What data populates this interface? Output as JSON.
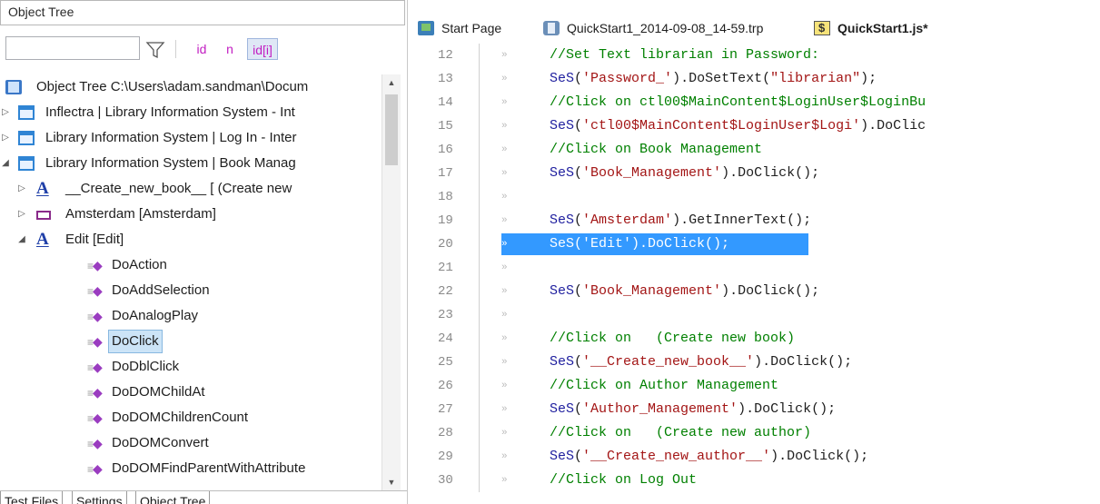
{
  "left_panel": {
    "title": "Object Tree",
    "filter": {
      "value": "",
      "placeholder": ""
    },
    "filter_buttons": [
      "id",
      "n",
      "id[i]"
    ],
    "tree_rows": [
      {
        "label": "Object Tree C:\\Users\\adam.sandman\\Docum",
        "icon": "object-tree-icon",
        "expander": ""
      },
      {
        "label": "Inflectra | Library Information System - Int",
        "icon": "window-icon",
        "expander": "▷"
      },
      {
        "label": "Library Information System | Log In - Inter",
        "icon": "window-icon",
        "expander": "▷"
      },
      {
        "label": "Library Information System | Book Manag",
        "icon": "window-icon",
        "expander": "◢"
      },
      {
        "label": "__Create_new_book__ [ (Create new",
        "icon": "link-icon",
        "expander": "▷"
      },
      {
        "label": "Amsterdam [Amsterdam]",
        "icon": "element-icon",
        "expander": "▷"
      },
      {
        "label": "Edit [Edit]",
        "icon": "link-icon",
        "expander": "◢"
      },
      {
        "label": "DoAction",
        "icon": "method-icon",
        "expander": ""
      },
      {
        "label": "DoAddSelection",
        "icon": "method-icon",
        "expander": ""
      },
      {
        "label": "DoAnalogPlay",
        "icon": "method-icon",
        "expander": ""
      },
      {
        "label": "DoClick",
        "icon": "method-icon",
        "expander": "",
        "selected": true
      },
      {
        "label": "DoDblClick",
        "icon": "method-icon",
        "expander": ""
      },
      {
        "label": "DoDOMChildAt",
        "icon": "method-icon",
        "expander": ""
      },
      {
        "label": "DoDOMChildrenCount",
        "icon": "method-icon",
        "expander": ""
      },
      {
        "label": "DoDOMConvert",
        "icon": "method-icon",
        "expander": ""
      },
      {
        "label": "DoDOMFindParentWithAttribute",
        "icon": "method-icon",
        "expander": ""
      }
    ],
    "bottom_tabs": [
      "Test Files",
      "Settings",
      "Object Tree"
    ]
  },
  "document_tabs": [
    {
      "label": "Start Page",
      "icon": "start-page-icon"
    },
    {
      "label": "QuickStart1_2014-09-08_14-59.trp",
      "icon": "report-file-icon"
    },
    {
      "label": "QuickStart1.js*",
      "icon": "script-file-icon",
      "active": true
    }
  ],
  "editor": {
    "gutter_marker": "»",
    "active_line": 20,
    "lines": [
      {
        "num": "12",
        "tokens": [
          {
            "t": "//Set Text librarian in Password:",
            "k": "com"
          }
        ]
      },
      {
        "num": "13",
        "tokens": [
          {
            "t": "SeS",
            "k": "fn"
          },
          {
            "t": "(",
            "k": "plain"
          },
          {
            "t": "'Password_'",
            "k": "str"
          },
          {
            "t": ").DoSetText(",
            "k": "plain"
          },
          {
            "t": "\"librarian\"",
            "k": "str"
          },
          {
            "t": ");",
            "k": "plain"
          }
        ]
      },
      {
        "num": "14",
        "tokens": [
          {
            "t": "//Click on ctl00$MainContent$LoginUser$LoginBu",
            "k": "com"
          }
        ]
      },
      {
        "num": "15",
        "tokens": [
          {
            "t": "SeS",
            "k": "fn"
          },
          {
            "t": "(",
            "k": "plain"
          },
          {
            "t": "'ctl00$MainContent$LoginUser$Logi'",
            "k": "str"
          },
          {
            "t": ").DoClic",
            "k": "plain"
          }
        ]
      },
      {
        "num": "16",
        "tokens": [
          {
            "t": "//Click on Book Management",
            "k": "com"
          }
        ]
      },
      {
        "num": "17",
        "tokens": [
          {
            "t": "SeS",
            "k": "fn"
          },
          {
            "t": "(",
            "k": "plain"
          },
          {
            "t": "'Book_Management'",
            "k": "str"
          },
          {
            "t": ").DoClick();",
            "k": "plain"
          }
        ]
      },
      {
        "num": "18",
        "tokens": []
      },
      {
        "num": "19",
        "tokens": [
          {
            "t": "SeS",
            "k": "fn"
          },
          {
            "t": "(",
            "k": "plain"
          },
          {
            "t": "'Amsterdam'",
            "k": "str"
          },
          {
            "t": ").GetInnerText();",
            "k": "plain"
          }
        ]
      },
      {
        "num": "20",
        "tokens": [
          {
            "t": "SeS('Edit').DoClick();",
            "k": "plain"
          }
        ]
      },
      {
        "num": "21",
        "tokens": []
      },
      {
        "num": "22",
        "tokens": [
          {
            "t": "SeS",
            "k": "fn"
          },
          {
            "t": "(",
            "k": "plain"
          },
          {
            "t": "'Book_Management'",
            "k": "str"
          },
          {
            "t": ").DoClick();",
            "k": "plain"
          }
        ]
      },
      {
        "num": "23",
        "tokens": []
      },
      {
        "num": "24",
        "tokens": [
          {
            "t": "//Click on   (Create new book)",
            "k": "com"
          }
        ]
      },
      {
        "num": "25",
        "tokens": [
          {
            "t": "SeS",
            "k": "fn"
          },
          {
            "t": "(",
            "k": "plain"
          },
          {
            "t": "'__Create_new_book__'",
            "k": "str"
          },
          {
            "t": ").DoClick();",
            "k": "plain"
          }
        ]
      },
      {
        "num": "26",
        "tokens": [
          {
            "t": "//Click on Author Management",
            "k": "com"
          }
        ]
      },
      {
        "num": "27",
        "tokens": [
          {
            "t": "SeS",
            "k": "fn"
          },
          {
            "t": "(",
            "k": "plain"
          },
          {
            "t": "'Author_Management'",
            "k": "str"
          },
          {
            "t": ").DoClick();",
            "k": "plain"
          }
        ]
      },
      {
        "num": "28",
        "tokens": [
          {
            "t": "//Click on   (Create new author)",
            "k": "com"
          }
        ]
      },
      {
        "num": "29",
        "tokens": [
          {
            "t": "SeS",
            "k": "fn"
          },
          {
            "t": "(",
            "k": "plain"
          },
          {
            "t": "'__Create_new_author__'",
            "k": "str"
          },
          {
            "t": ").DoClick();",
            "k": "plain"
          }
        ]
      },
      {
        "num": "30",
        "tokens": [
          {
            "t": "//Click on Log Out",
            "k": "com"
          }
        ]
      }
    ]
  },
  "colors": {
    "selection": "#3399ff",
    "comment": "#008000",
    "string": "#a31515",
    "function": "#1e1e9e",
    "filter_accent": "#c21ec2"
  }
}
